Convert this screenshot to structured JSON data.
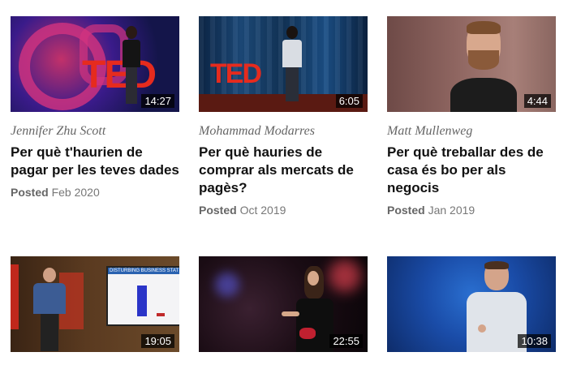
{
  "colors": {
    "ted_red": "#e62b1e"
  },
  "videos": [
    {
      "speaker": "Jennifer Zhu Scott",
      "title": "Per què t'haurien de pagar per les teves dades",
      "posted_label": "Posted",
      "date": "Feb 2020",
      "duration": "14:27",
      "logo": "TED"
    },
    {
      "speaker": "Mohammad Modarres",
      "title": "Per què hauries de comprar als mercats de pagès?",
      "posted_label": "Posted",
      "date": "Oct 2019",
      "duration": "6:05",
      "logo": "TED"
    },
    {
      "speaker": "Matt Mullenweg",
      "title": "Per què treballar des de casa és bo per als negocis",
      "posted_label": "Posted",
      "date": "Jan 2019",
      "duration": "4:44"
    },
    {
      "duration": "19:05",
      "slide_heading": "DISTURBING BUSINESS STAT"
    },
    {
      "duration": "22:55"
    },
    {
      "duration": "10:38"
    }
  ]
}
